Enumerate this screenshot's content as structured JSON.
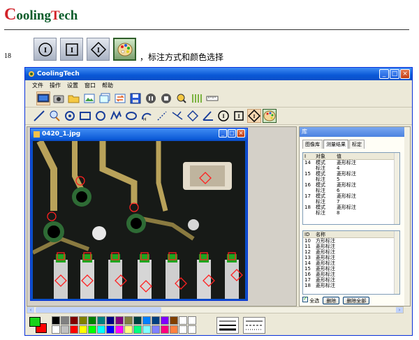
{
  "brand": {
    "first": "C",
    "mid1": "ooling",
    "t": "T",
    "rest": "ech"
  },
  "caption": {
    "number": "18",
    "text": "，标注方式和颜色选择"
  },
  "window": {
    "title": "CoolingTech",
    "menu": [
      "文件",
      "操作",
      "设置",
      "窗口",
      "帮助"
    ]
  },
  "image_window": {
    "title": "0420_1.jpg"
  },
  "panel": {
    "header": "库",
    "tabs": [
      "图像库",
      "测量结果",
      "标定"
    ],
    "list1": {
      "headers": [
        "I",
        "对象",
        "值"
      ],
      "rows": [
        [
          "14",
          "模式",
          "菱形标注"
        ],
        [
          "",
          "标注",
          "4"
        ],
        [
          "15",
          "模式",
          "菱形标注"
        ],
        [
          "",
          "标注",
          "5"
        ],
        [
          "16",
          "模式",
          "菱形标注"
        ],
        [
          "",
          "标注",
          "6"
        ],
        [
          "17",
          "模式",
          "菱形标注"
        ],
        [
          "",
          "标注",
          "7"
        ],
        [
          "18",
          "模式",
          "菱形标注"
        ],
        [
          "",
          "标注",
          "8"
        ]
      ]
    },
    "list2": {
      "headers": [
        "ID",
        "名称"
      ],
      "rows": [
        [
          "10",
          "方形标注"
        ],
        [
          "11",
          "菱形标注"
        ],
        [
          "12",
          "菱形标注"
        ],
        [
          "13",
          "菱形标注"
        ],
        [
          "14",
          "菱形标注"
        ],
        [
          "15",
          "菱形标注"
        ],
        [
          "16",
          "菱形标注"
        ],
        [
          "17",
          "菱形标注"
        ],
        [
          "18",
          "菱形标注"
        ]
      ]
    },
    "select_all": "全选",
    "delete": "删除",
    "delete_all": "删除全部"
  },
  "colors": {
    "foreground": "#19d219",
    "background": "#ff0000",
    "palette": [
      "#000000",
      "#808080",
      "#800000",
      "#808000",
      "#008000",
      "#008080",
      "#000080",
      "#800080",
      "#808040",
      "#004040",
      "#0080ff",
      "#004080",
      "#8000ff",
      "#804000",
      "#ffffff",
      "#ffffff",
      "#ffffff",
      "#c0c0c0",
      "#ff0000",
      "#ffff00",
      "#00ff00",
      "#00ffff",
      "#0000ff",
      "#ff00ff",
      "#ffff80",
      "#00ff80",
      "#80ffff",
      "#8080ff",
      "#ff0080",
      "#ff8040",
      "#ffffff",
      "#ffffff"
    ]
  }
}
